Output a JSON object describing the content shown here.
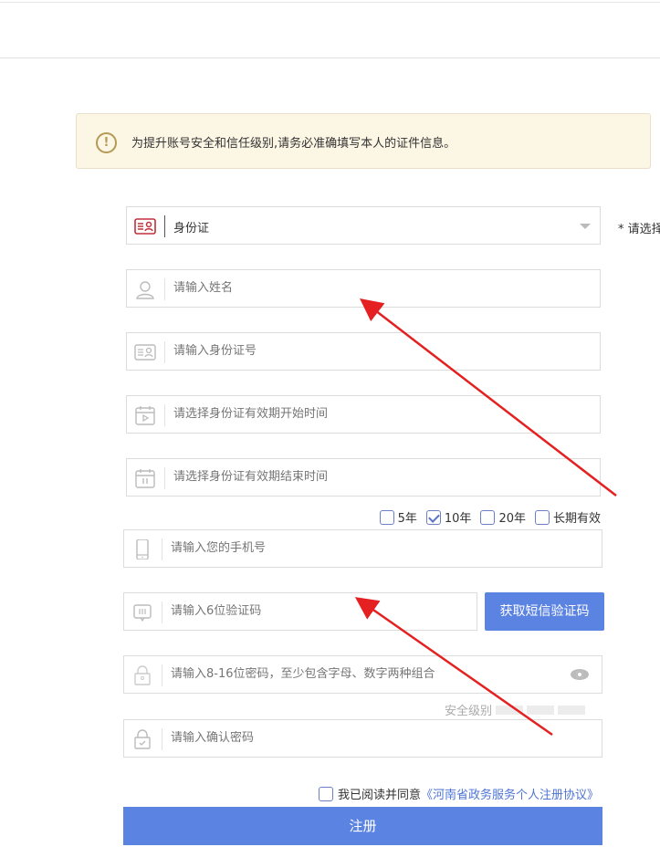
{
  "notice": {
    "icon": "exclamation-circle-icon",
    "text": "为提升账号安全和信任级别,请务必准确填写本人的证件信息。"
  },
  "id_type": {
    "value": "身份证",
    "hint": "* 请选择"
  },
  "fields": {
    "name": "请输入姓名",
    "id_number": "请输入身份证号",
    "valid_start": "请选择身份证有效期开始时间",
    "valid_end": "请选择身份证有效期结束时间",
    "phone": "请输入您的手机号",
    "sms_code": "请输入6位验证码",
    "password": "请输入8-16位密码，至少包含字母、数字两种组合",
    "confirm_password": "请输入确认密码"
  },
  "validity": [
    {
      "label": "5年",
      "checked": false
    },
    {
      "label": "10年",
      "checked": true
    },
    {
      "label": "20年",
      "checked": false
    },
    {
      "label": "长期有效",
      "checked": false
    }
  ],
  "sms_button": "获取短信验证码",
  "strength_label": "安全级别",
  "agree": {
    "text": "我已阅读并同意",
    "link": "《河南省政务服务个人注册协议》"
  },
  "register": "注册",
  "colors": {
    "primary": "#5b83e2",
    "notice_bg": "#fcf6e4",
    "arrow": "#e52020"
  }
}
